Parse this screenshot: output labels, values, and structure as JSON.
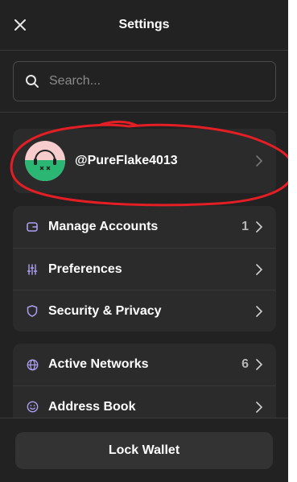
{
  "header": {
    "title": "Settings"
  },
  "search": {
    "placeholder": "Search..."
  },
  "profile": {
    "username": "@PureFlake4013"
  },
  "account_items": [
    {
      "label": "Manage Accounts",
      "count": "1",
      "icon": "wallet-icon"
    },
    {
      "label": "Preferences",
      "count": "",
      "icon": "sliders-icon"
    },
    {
      "label": "Security & Privacy",
      "count": "",
      "icon": "shield-icon"
    }
  ],
  "network_items": [
    {
      "label": "Active Networks",
      "count": "6",
      "icon": "globe-icon"
    },
    {
      "label": "Address Book",
      "count": "",
      "icon": "smiley-icon"
    }
  ],
  "footer": {
    "lock_label": "Lock Wallet"
  },
  "colors": {
    "background": "#222222",
    "card": "#2b2b2b",
    "accent_icon": "#ab9ff2",
    "annotation": "#e31e24",
    "avatar_bg": "#f7cccc",
    "avatar_fg": "#2bb673"
  }
}
